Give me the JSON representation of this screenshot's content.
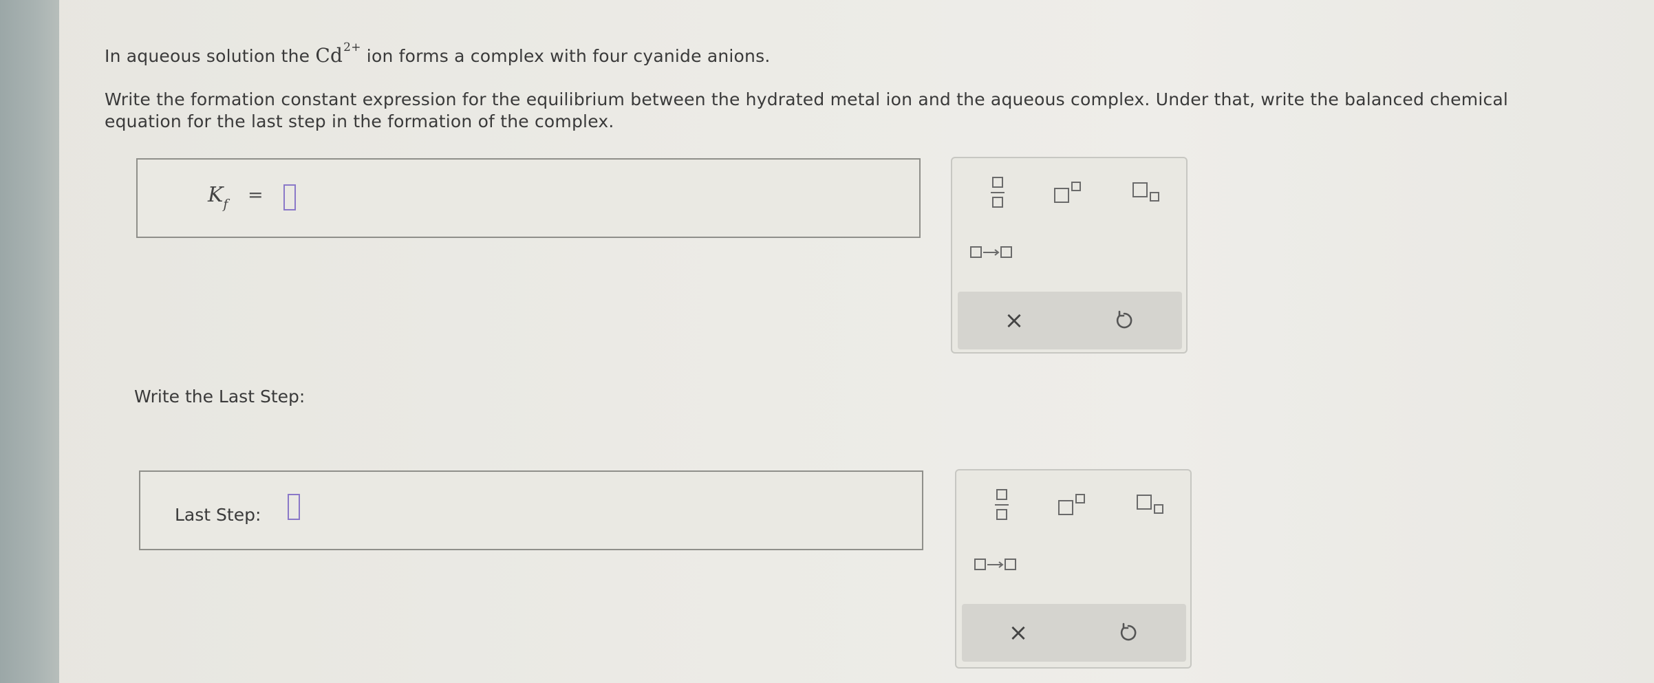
{
  "question": {
    "line1_before": "In aqueous solution the",
    "ion_symbol": "Cd",
    "ion_charge": "2+",
    "line1_after": "ion forms a complex with four cyanide anions.",
    "line2": "Write the formation constant expression for the equilibrium between the hydrated metal ion and the aqueous complex. Under that, write the balanced chemical",
    "line3": "equation for the last step in the formation of the complex."
  },
  "kf_box": {
    "symbol": "K",
    "subscript": "f",
    "equals": "="
  },
  "last_step_section": {
    "heading": "Write the Last Step:",
    "box_label": "Last Step:"
  },
  "palette_tools": {
    "fraction": "fraction-icon",
    "superscript": "superscript-icon",
    "subscript": "subscript-icon",
    "reaction_arrow": "reaction-arrow-icon",
    "clear": "×",
    "undo": "undo-icon"
  },
  "colors": {
    "placeholder_border": "#8a78c8",
    "icon_gray": "#6a6a6a",
    "action_bar": "#d5d4cf"
  }
}
